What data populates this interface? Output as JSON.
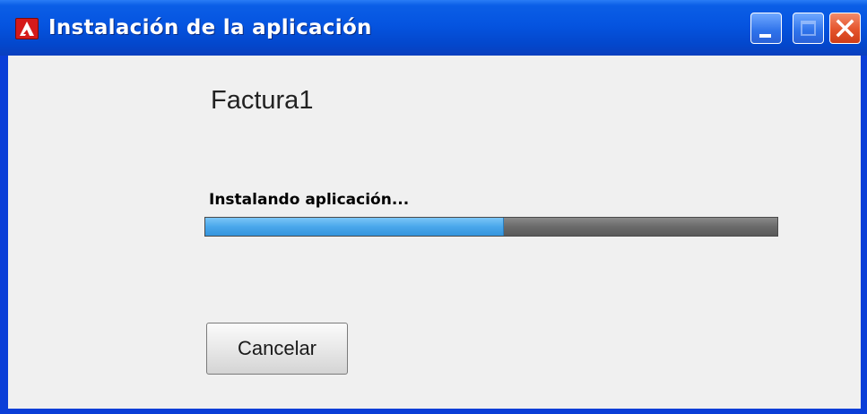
{
  "window": {
    "title": "Instalación de la aplicación",
    "app_icon": "adobe-air-icon",
    "controls": {
      "minimize_icon": "minimize-icon",
      "maximize_icon": "maximize-icon",
      "close_icon": "close-icon"
    }
  },
  "content": {
    "app_name": "Factura1",
    "status_text": "Instalando aplicación...",
    "progress": 0.52,
    "cancel_label": "Cancelar"
  },
  "colors": {
    "titlebar": "#0554e0",
    "client_background": "#f0f0f0",
    "progress_fill": "#4aa7eb",
    "progress_track": "#6a6a6a",
    "close_button": "#e4542c"
  }
}
